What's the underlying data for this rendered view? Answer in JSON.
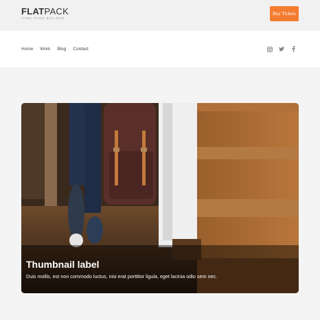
{
  "brand": {
    "logo_bold": "FLAT",
    "logo_light": "PACK",
    "tagline": "HTML PAGE BUILDER"
  },
  "header": {
    "cta_label": "Buy Tickets"
  },
  "nav": {
    "items": [
      "Home",
      "Work",
      "Blog",
      "Contact"
    ]
  },
  "social": {
    "icons": [
      "instagram-icon",
      "twitter-icon",
      "facebook-icon"
    ]
  },
  "thumbnail": {
    "label": "Thumbnail label",
    "text": "Duis mollis, est non commodo luctus, nisi erat porttitor ligula, eget lacinia odio sem nec."
  },
  "colors": {
    "accent": "#f47c30",
    "topbar": "#f1f1f1",
    "page": "#f4f4f4"
  }
}
